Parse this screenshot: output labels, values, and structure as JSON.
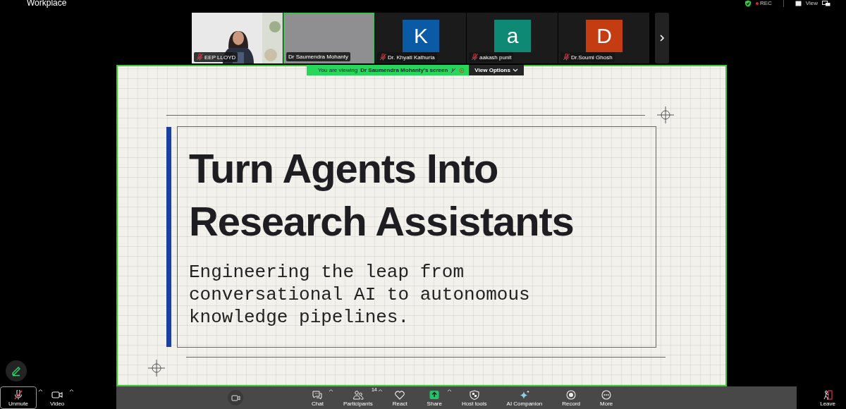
{
  "window": {
    "title": "Workplace"
  },
  "status": {
    "recording": "REC",
    "view": "View"
  },
  "participants": [
    {
      "name": "EEP LLOYD",
      "kind": "video",
      "muted": true,
      "speaking": false
    },
    {
      "name": "Dr Saumendra Mohanty",
      "kind": "blurred",
      "muted": false,
      "speaking": true
    },
    {
      "name": "Dr. Khyati Kathuria",
      "kind": "avatar",
      "initial": "K",
      "color": "#0b5aa6",
      "muted": true,
      "speaking": false
    },
    {
      "name": "aakash punit",
      "kind": "avatar",
      "initial": "a",
      "color": "#0e8a74",
      "muted": true,
      "speaking": false
    },
    {
      "name": "Dr.Soumi Ghosh",
      "kind": "avatar",
      "initial": "D",
      "color": "#c43c12",
      "muted": true,
      "speaking": false
    }
  ],
  "share_banner": {
    "prefix": "You are viewing",
    "owner": "Dr Saumendra Mohanty's screen",
    "button": "View Options"
  },
  "slide": {
    "title_lines": [
      "Turn Agents Into",
      "Research Assistants"
    ],
    "subtitle_lines": [
      "Engineering the leap from",
      "conversational AI to autonomous",
      "knowledge pipelines."
    ]
  },
  "toolbar": {
    "left": [
      {
        "kind": "mic",
        "label": "Unmute",
        "muted": true,
        "caret": true
      },
      {
        "kind": "video",
        "label": "Video",
        "caret": true
      }
    ],
    "center": [
      {
        "kind": "chat",
        "label": "Chat",
        "caret": true
      },
      {
        "kind": "participants",
        "label": "Participants",
        "count": "14",
        "caret": true
      },
      {
        "kind": "react",
        "label": "React",
        "caret": false
      },
      {
        "kind": "share",
        "label": "Share",
        "caret": true
      },
      {
        "kind": "host",
        "label": "Host tools",
        "caret": false
      },
      {
        "kind": "ai",
        "label": "AI Companion",
        "caret": false
      },
      {
        "kind": "record",
        "label": "Record",
        "caret": false
      },
      {
        "kind": "more",
        "label": "More",
        "caret": false
      }
    ],
    "right": [
      {
        "kind": "leave",
        "label": "Leave",
        "caret": false
      }
    ]
  }
}
